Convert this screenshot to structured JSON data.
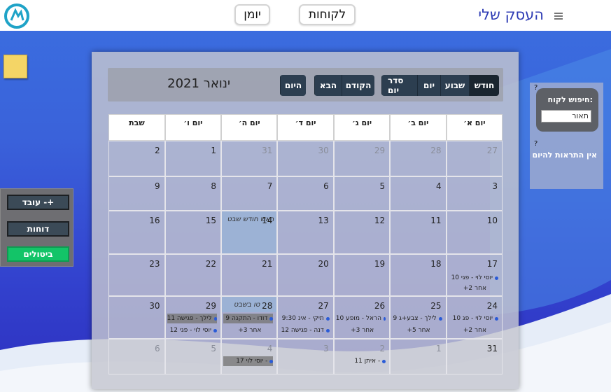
{
  "header": {
    "brand": "העסק שלי",
    "nav": {
      "clients": "לקוחות",
      "diary": "יומן"
    }
  },
  "left_panel": {
    "add_worker": "עובד -+",
    "reports": "דוחות",
    "cancellations": "ביטולים"
  },
  "calendar": {
    "title": "ינואר 2021",
    "view_buttons": {
      "month": "חודש",
      "week": "שבוע",
      "day": "יום",
      "agenda": "סדר יום"
    },
    "nav_buttons": {
      "prev": "הקודם",
      "next": "הבא",
      "today": "היום"
    },
    "weekdays": [
      "יום א׳",
      "יום ב׳",
      "יום ג׳",
      "יום ד׳",
      "יום ה׳",
      "יום ו׳",
      "שבת"
    ],
    "weeks": [
      [
        {
          "d": "27",
          "m": true
        },
        {
          "d": "28",
          "m": true
        },
        {
          "d": "29",
          "m": true
        },
        {
          "d": "30",
          "m": true
        },
        {
          "d": "31",
          "m": true
        },
        {
          "d": "1"
        },
        {
          "d": "2"
        }
      ],
      [
        {
          "d": "3"
        },
        {
          "d": "4"
        },
        {
          "d": "5"
        },
        {
          "d": "6"
        },
        {
          "d": "7"
        },
        {
          "d": "8"
        },
        {
          "d": "9"
        }
      ],
      [
        {
          "d": "10"
        },
        {
          "d": "11"
        },
        {
          "d": "12"
        },
        {
          "d": "13"
        },
        {
          "d": "14",
          "holiday": "ראש חודש שבט"
        },
        {
          "d": "15"
        },
        {
          "d": "16"
        }
      ],
      [
        {
          "d": "17",
          "events": [
            "10 יוסי לוי - פגי"
          ],
          "more": "+2 אחר"
        },
        {
          "d": "18"
        },
        {
          "d": "19"
        },
        {
          "d": "20"
        },
        {
          "d": "21"
        },
        {
          "d": "22"
        },
        {
          "d": "23"
        }
      ],
      [
        {
          "d": "24",
          "events": [
            "10 יוסי לוי - פג"
          ],
          "more": "+2 אחר"
        },
        {
          "d": "25",
          "events": [
            "9 לילך - צבע+ג"
          ],
          "more": "+5 אחר"
        },
        {
          "d": "26",
          "events": [
            "10 הראל - מופע"
          ],
          "more": "+3 אחר"
        },
        {
          "d": "27",
          "events": [
            "9:30 תיקי - אינ",
            "12 דנה - פגישה"
          ]
        },
        {
          "d": "28",
          "holiday": "טו בשבט",
          "events": [
            "9 דודו - התקנה"
          ],
          "more": "+3 אחר"
        },
        {
          "d": "29",
          "events": [
            "11 לילך - פגישה",
            "12 יוסי לוי - פגי"
          ]
        },
        {
          "d": "30"
        }
      ],
      [
        {
          "d": "31"
        },
        {
          "d": "1",
          "m": true
        },
        {
          "d": "2",
          "m": true,
          "events": [
            "11 איתן -"
          ]
        },
        {
          "d": "3",
          "m": true
        },
        {
          "d": "4",
          "m": true,
          "events": [
            "17 יוסי לוי -"
          ]
        },
        {
          "d": "5",
          "m": true
        },
        {
          "d": "6",
          "m": true
        }
      ]
    ]
  },
  "client_search": {
    "label": "חיפוש לקוח:",
    "placeholder": "תאור",
    "help": "?"
  },
  "alerts": {
    "text": "אין התראות להיום",
    "help": "?"
  }
}
